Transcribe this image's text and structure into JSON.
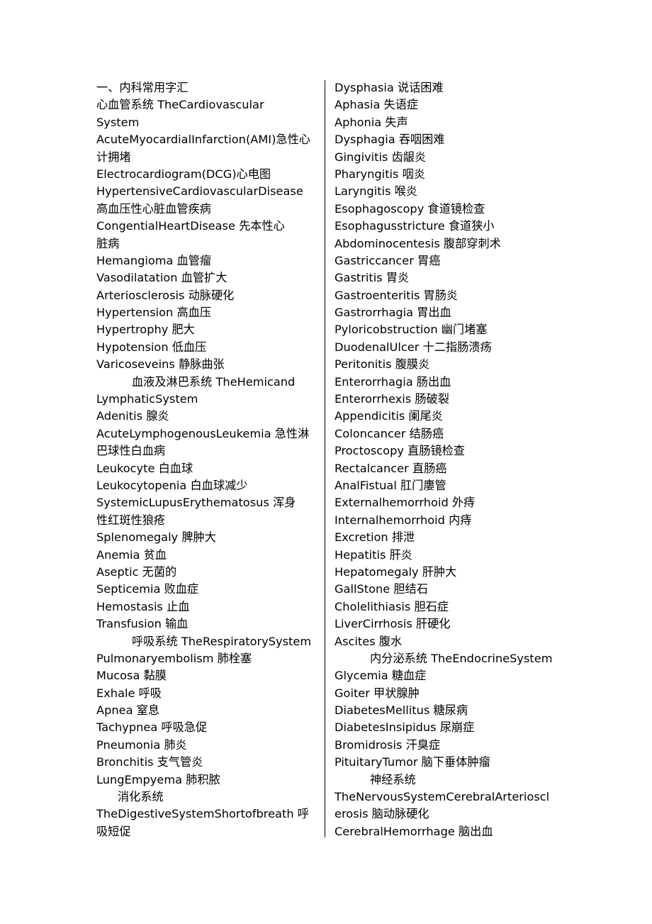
{
  "document": {
    "title_line": "一、内科常用字汇",
    "columns": {
      "left": {
        "lines": [
          {
            "text": "一、内科常用字汇",
            "indent": 0
          },
          {
            "text": "心血管系统 TheCardiovascular",
            "indent": 0
          },
          {
            "text": "System",
            "indent": 0
          },
          {
            "text": "AcuteMyocardialInfarction(AMI)急性心",
            "indent": 0
          },
          {
            "text": "计拥堵",
            "indent": 0
          },
          {
            "text": "Electrocardiogram(DCG)心电图",
            "indent": 0
          },
          {
            "text": "HypertensiveCardiovascularDisease",
            "indent": 0
          },
          {
            "text": "高血压性心脏血管疾病",
            "indent": 0
          },
          {
            "text": "CongentialHeartDisease 先本性心",
            "indent": 0
          },
          {
            "text": "脏病",
            "indent": 0
          },
          {
            "text": "Hemangioma 血管瘤",
            "indent": 0
          },
          {
            "text": "Vasodilatation 血管扩大",
            "indent": 0
          },
          {
            "text": "Arteriosclerosis 动脉硬化",
            "indent": 0
          },
          {
            "text": "Hypertension 高血压",
            "indent": 0
          },
          {
            "text": "Hypertrophy 肥大",
            "indent": 0
          },
          {
            "text": "Hypotension 低血压",
            "indent": 0
          },
          {
            "text": "Varicoseveins 静脉曲张",
            "indent": 0
          },
          {
            "text": "血液及淋巴系统 TheHemicand",
            "indent": 50
          },
          {
            "text": "LymphaticSystem",
            "indent": 0
          },
          {
            "text": "Adenitis 腺炎",
            "indent": 0
          },
          {
            "text": "AcuteLymphogenousLeukemia 急性淋",
            "indent": 0
          },
          {
            "text": "巴球性白血病",
            "indent": 0
          },
          {
            "text": "Leukocyte 白血球",
            "indent": 0
          },
          {
            "text": "Leukocytopenia 白血球减少",
            "indent": 0
          },
          {
            "text": "SystemicLupusErythematosus 浑身",
            "indent": 0
          },
          {
            "text": "性红斑性狼疮",
            "indent": 0
          },
          {
            "text": "Splenomegaly 脾肿大",
            "indent": 0
          },
          {
            "text": "Anemia 贫血",
            "indent": 0
          },
          {
            "text": "Aseptic 无菌的",
            "indent": 0
          },
          {
            "text": "Septicemia 败血症",
            "indent": 0
          },
          {
            "text": "Hemostasis 止血",
            "indent": 0
          },
          {
            "text": "Transfusion 输血",
            "indent": 0
          },
          {
            "text": "呼吸系统 TheRespiratorySystem",
            "indent": 50
          },
          {
            "text": "Pulmonaryembolism 肺栓塞",
            "indent": 0
          },
          {
            "text": "Mucosa 黏膜",
            "indent": 0
          },
          {
            "text": "Exhale 呼吸",
            "indent": 0
          },
          {
            "text": "Apnea 窒息",
            "indent": 0
          },
          {
            "text": "Tachypnea 呼吸急促",
            "indent": 0
          },
          {
            "text": "Pneumonia 肺炎",
            "indent": 0
          },
          {
            "text": "Bronchitis 支气管炎",
            "indent": 0
          },
          {
            "text": "LungEmpyema 肺积脓",
            "indent": 0
          },
          {
            "text": "消化系统",
            "indent": 30
          },
          {
            "text": "TheDigestiveSystemShortofbreath 呼",
            "indent": 0
          },
          {
            "text": "吸短促",
            "indent": 0
          }
        ]
      },
      "right": {
        "lines": [
          {
            "text": "Dysphasia 说话困难",
            "indent": 0
          },
          {
            "text": "Aphasia 失语症",
            "indent": 0
          },
          {
            "text": "Aphonia 失声",
            "indent": 0
          },
          {
            "text": "Dysphagia 吞咽困难",
            "indent": 0
          },
          {
            "text": "Gingivitis 齿龈炎",
            "indent": 0
          },
          {
            "text": "Pharyngitis 咽炎",
            "indent": 0
          },
          {
            "text": "Laryngitis 喉炎",
            "indent": 0
          },
          {
            "text": "Esophagoscopy 食道镜检查",
            "indent": 0
          },
          {
            "text": "Esophagusstricture 食道狭小",
            "indent": 0
          },
          {
            "text": "Abdominocentesis 腹部穿刺术",
            "indent": 0
          },
          {
            "text": "Gastriccancer 胃癌",
            "indent": 0
          },
          {
            "text": "Gastritis 胃炎",
            "indent": 0
          },
          {
            "text": "Gastroenteritis 胃肠炎",
            "indent": 0
          },
          {
            "text": "Gastrorrhagia 胃出血",
            "indent": 0
          },
          {
            "text": "Pyloricobstruction 幽门堵塞",
            "indent": 0
          },
          {
            "text": "DuodenalUlcer 十二指肠溃疡",
            "indent": 0
          },
          {
            "text": "Peritonitis 腹膜炎",
            "indent": 0
          },
          {
            "text": "Enterorrhagia 肠出血",
            "indent": 0
          },
          {
            "text": "Enterorrhexis 肠破裂",
            "indent": 0
          },
          {
            "text": "Appendicitis 阑尾炎",
            "indent": 0
          },
          {
            "text": "Coloncancer 结肠癌",
            "indent": 0
          },
          {
            "text": "Proctoscopy 直肠镜检查",
            "indent": 0
          },
          {
            "text": "Rectalcancer 直肠癌",
            "indent": 0
          },
          {
            "text": "AnalFistual 肛门廔管",
            "indent": 0
          },
          {
            "text": "Externalhemorrhoid 外痔",
            "indent": 0
          },
          {
            "text": "Internalhemorrhoid 内痔",
            "indent": 0
          },
          {
            "text": "Excretion 排泄",
            "indent": 0
          },
          {
            "text": "Hepatitis 肝炎",
            "indent": 0
          },
          {
            "text": "Hepatomegaly 肝肿大",
            "indent": 0
          },
          {
            "text": "GallStone 胆结石",
            "indent": 0
          },
          {
            "text": "Cholelithiasis 胆石症",
            "indent": 0
          },
          {
            "text": "LiverCirrhosis 肝硬化",
            "indent": 0
          },
          {
            "text": "Ascites 腹水",
            "indent": 0
          },
          {
            "text": "内分泌系统 TheEndocrineSystem",
            "indent": 50
          },
          {
            "text": "Glycemia 糖血症",
            "indent": 0
          },
          {
            "text": "Goiter 甲状腺肿",
            "indent": 0
          },
          {
            "text": "DiabetesMellitus 糖尿病",
            "indent": 0
          },
          {
            "text": "DiabetesInsipidus 尿崩症",
            "indent": 0
          },
          {
            "text": "Bromidrosis 汗臭症",
            "indent": 0
          },
          {
            "text": "PituitaryTumor 脑下垂体肿瘤",
            "indent": 0
          },
          {
            "text": "神经系统",
            "indent": 50
          },
          {
            "text": "TheNervousSystemCerebralArterioscl",
            "indent": 0
          },
          {
            "text": "erosis 脑动脉硬化",
            "indent": 0
          },
          {
            "text": "CerebralHemorrhage 脑出血",
            "indent": 0
          }
        ]
      }
    }
  }
}
